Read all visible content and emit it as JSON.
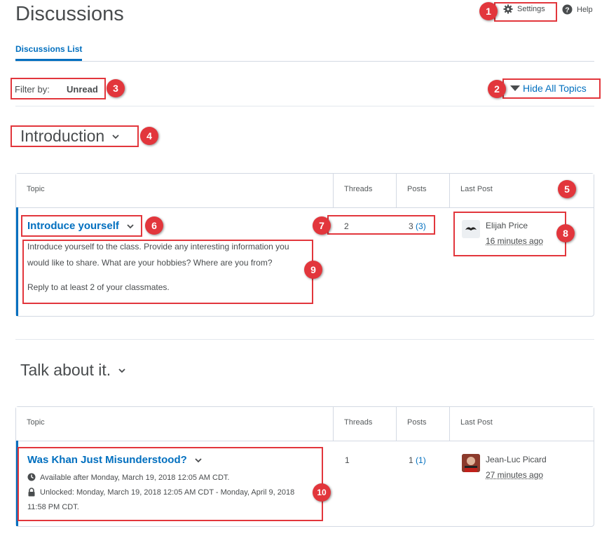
{
  "header": {
    "title": "Discussions",
    "settings_label": "Settings",
    "help_label": "Help"
  },
  "tabs": [
    {
      "label": "Discussions List"
    }
  ],
  "filter": {
    "label": "Filter by:",
    "value": "Unread"
  },
  "hide_topics_label": "Hide All Topics",
  "table_headers": {
    "topic": "Topic",
    "threads": "Threads",
    "posts": "Posts",
    "last_post": "Last Post"
  },
  "forums": [
    {
      "title": "Introduction",
      "topics": [
        {
          "title": "Introduce yourself",
          "description_lines": [
            "Introduce yourself to the class. Provide any interesting information you",
            "would like to share. What are your hobbies? Where are you from?",
            "Reply to at least 2 of your classmates."
          ],
          "threads": "2",
          "posts": "3",
          "unread_posts": "(3)",
          "last_post_author": "Elijah Price",
          "last_post_time": "16 minutes ago"
        }
      ]
    },
    {
      "title": "Talk about it.",
      "topics": [
        {
          "title": "Was Khan Just Misunderstood?",
          "availability": "Available after Monday, March 19, 2018 12:05 AM CDT.",
          "unlocked_line1": "Unlocked: Monday, March 19, 2018 12:05 AM CDT - Monday, April 9, 2018",
          "unlocked_line2": "11:58 PM CDT.",
          "threads": "1",
          "posts": "1",
          "unread_posts": "(1)",
          "last_post_author": "Jean-Luc Picard",
          "last_post_time": "27 minutes ago"
        }
      ]
    }
  ],
  "callouts": [
    "1",
    "2",
    "3",
    "4",
    "5",
    "6",
    "7",
    "8",
    "9",
    "10"
  ],
  "colors": {
    "link": "#006fbf",
    "callout": "#e2363c",
    "text": "#494c4e"
  }
}
